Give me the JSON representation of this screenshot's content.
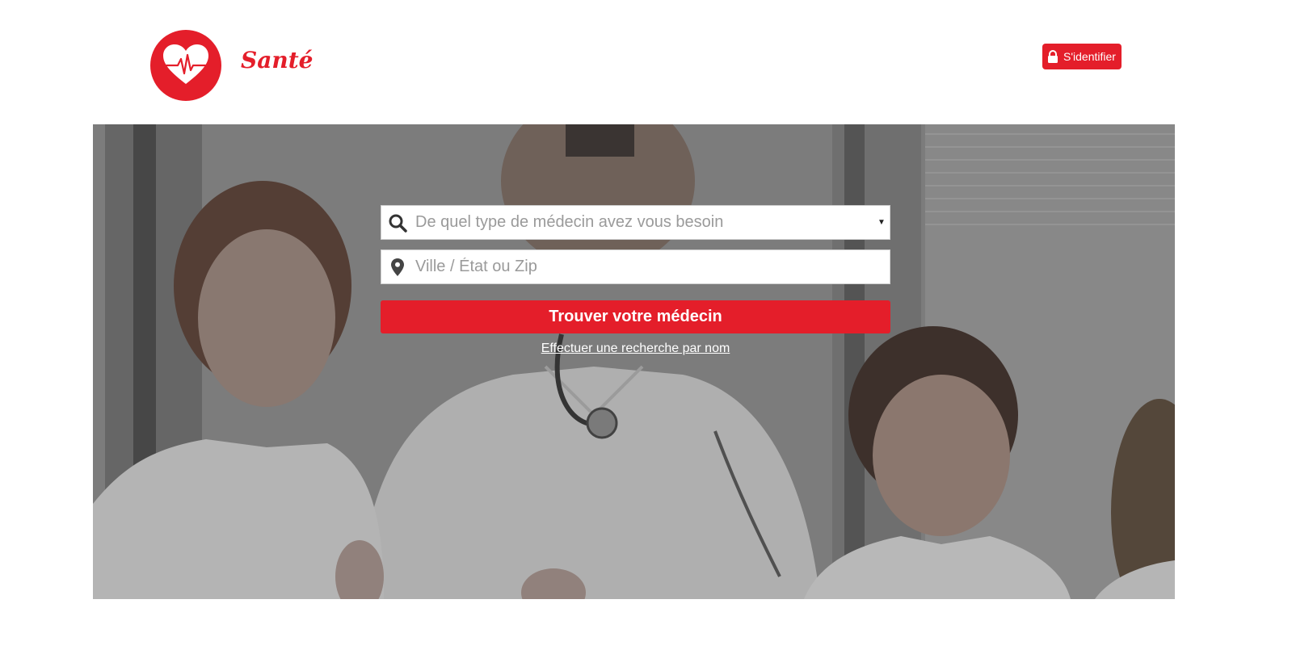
{
  "header": {
    "brand": "Santé",
    "login_label": "S'identifier"
  },
  "search": {
    "specialty_placeholder": "De quel type de médecin avez vous besoin",
    "location_placeholder": "Ville / État ou Zip",
    "submit_label": "Trouver votre médecin",
    "name_search_link": "Effectuer une recherche par nom"
  },
  "icons": {
    "logo": "heart-pulse-icon",
    "login": "lock-icon",
    "specialty": "search-icon",
    "location": "map-pin-icon",
    "dropdown": "caret-down-icon"
  },
  "colors": {
    "brand_red": "#e41e2a",
    "link_white": "#ffffff"
  }
}
